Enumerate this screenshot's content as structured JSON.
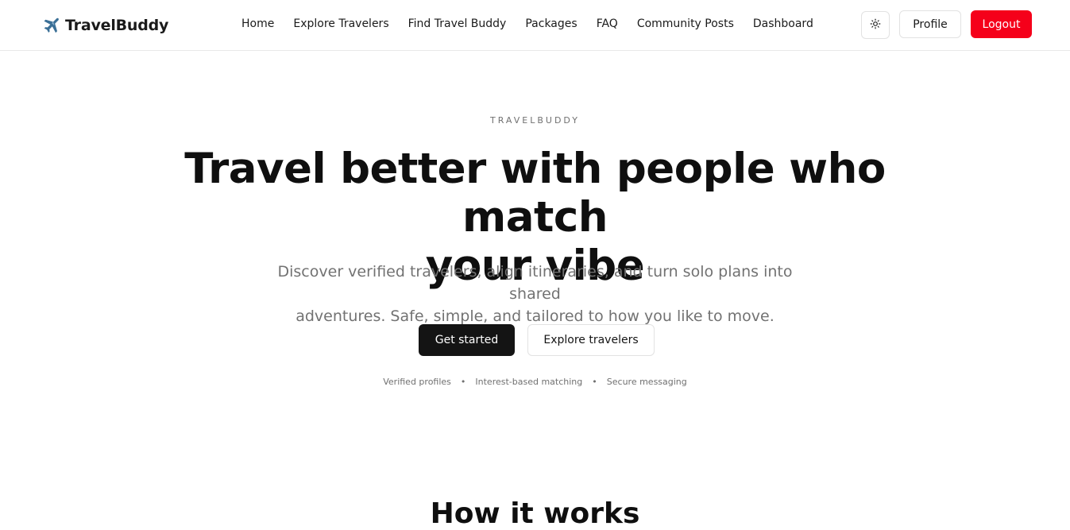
{
  "brand": {
    "name": "TravelBuddy",
    "icon": "airplane-icon"
  },
  "nav": {
    "links": [
      {
        "label": "Home"
      },
      {
        "label": "Explore Travelers"
      },
      {
        "label": "Find Travel Buddy"
      },
      {
        "label": "Packages"
      },
      {
        "label": "FAQ"
      },
      {
        "label": "Community Posts"
      },
      {
        "label": "Dashboard"
      }
    ],
    "theme_icon": "sun-icon",
    "profile_label": "Profile",
    "logout_label": "Logout"
  },
  "hero": {
    "eyebrow": "TRAVELBUDDY",
    "title_line1": "Travel better with people who match",
    "title_line2": "your vibe",
    "subtitle_line1": "Discover verified travelers, align itineraries, and turn solo plans into shared",
    "subtitle_line2": "adventures. Safe, simple, and tailored to how you like to move.",
    "primary_cta": "Get started",
    "secondary_cta": "Explore travelers",
    "features": [
      "Verified profiles",
      "Interest-based matching",
      "Secure messaging"
    ],
    "separator": "•"
  },
  "how_it_works": {
    "heading": "How it works"
  },
  "colors": {
    "accent_red": "#f5001a",
    "primary_dark": "#141414",
    "muted_text": "#727272",
    "border": "#e2e2e2"
  }
}
